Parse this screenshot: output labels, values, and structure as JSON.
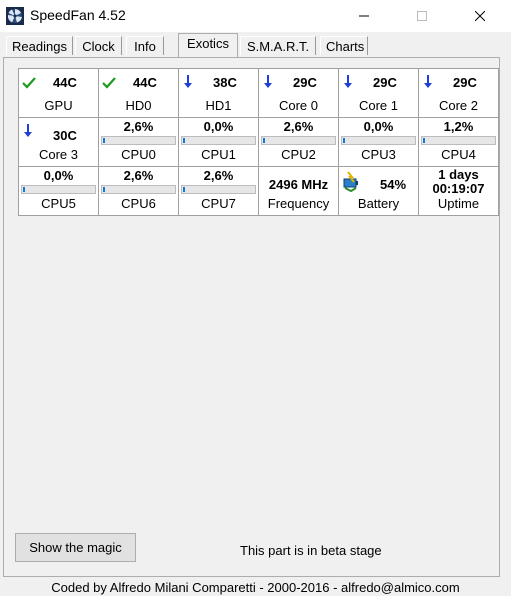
{
  "window": {
    "title": "SpeedFan 4.52"
  },
  "tabs": [
    {
      "label": "Readings"
    },
    {
      "label": "Clock"
    },
    {
      "label": "Info"
    },
    {
      "label": "Exotics"
    },
    {
      "label": "S.M.A.R.T."
    },
    {
      "label": "Charts"
    }
  ],
  "active_tab": "Exotics",
  "sensors": {
    "gpu": {
      "value": "44C",
      "label": "GPU",
      "status_icon": "check-icon"
    },
    "hd0": {
      "value": "44C",
      "label": "HD0",
      "status_icon": "check-icon"
    },
    "hd1": {
      "value": "38C",
      "label": "HD1",
      "status_icon": "arrow-down-icon"
    },
    "core0": {
      "value": "29C",
      "label": "Core 0",
      "status_icon": "arrow-down-icon"
    },
    "core1": {
      "value": "29C",
      "label": "Core 1",
      "status_icon": "arrow-down-icon"
    },
    "core2": {
      "value": "29C",
      "label": "Core 2",
      "status_icon": "arrow-down-icon"
    },
    "core3": {
      "value": "30C",
      "label": "Core 3",
      "status_icon": "arrow-down-icon"
    }
  },
  "cpus": [
    {
      "id": "cpu0",
      "value": "2,6%",
      "label": "CPU0",
      "load": 0.026
    },
    {
      "id": "cpu1",
      "value": "0,0%",
      "label": "CPU1",
      "load": 0.0
    },
    {
      "id": "cpu2",
      "value": "2,6%",
      "label": "CPU2",
      "load": 0.026
    },
    {
      "id": "cpu3",
      "value": "0,0%",
      "label": "CPU3",
      "load": 0.0
    },
    {
      "id": "cpu4",
      "value": "1,2%",
      "label": "CPU4",
      "load": 0.012
    },
    {
      "id": "cpu5",
      "value": "0,0%",
      "label": "CPU5",
      "load": 0.0
    },
    {
      "id": "cpu6",
      "value": "2,6%",
      "label": "CPU6",
      "load": 0.026
    },
    {
      "id": "cpu7",
      "value": "2,6%",
      "label": "CPU7",
      "load": 0.026
    }
  ],
  "frequency": {
    "value": "2496 MHz",
    "label": "Frequency"
  },
  "battery": {
    "value": "54%",
    "label": "Battery",
    "icon": "battery-plug-icon"
  },
  "uptime": {
    "days": "1 days",
    "time": "00:19:07",
    "label": "Uptime"
  },
  "buttons": {
    "magic": "Show the magic"
  },
  "beta_note": "This part is in beta stage",
  "footer": "Coded by Alfredo Milani Comparetti - 2000-2016 - alfredo@almico.com",
  "colors": {
    "check": "#1e9a1e",
    "arrow": "#1f3fd6",
    "bar_fill": "#0a7ad6"
  }
}
